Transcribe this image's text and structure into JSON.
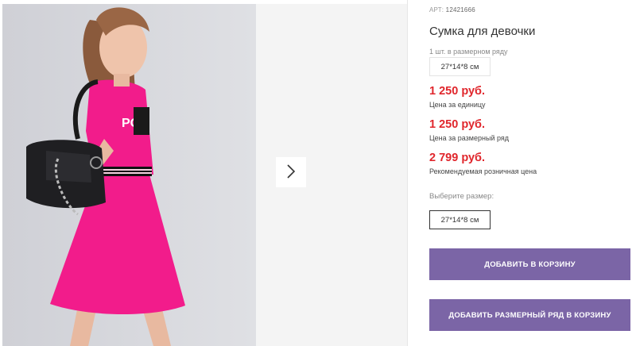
{
  "gallery": {
    "photo_alt": "product-photo",
    "next_icon": "chevron-right-icon"
  },
  "product": {
    "article_label": "АРТ:",
    "article_code": "12421666",
    "title": "Сумка для девочки",
    "set_note": "1 шт. в размерном ряду",
    "set_size": "27*14*8 см"
  },
  "prices": [
    {
      "value": "1 250 руб.",
      "label": "Цена за единицу"
    },
    {
      "value": "1 250 руб.",
      "label": "Цена за размерный ряд"
    },
    {
      "value": "2 799 руб.",
      "label": "Рекомендуемая розничная цена"
    }
  ],
  "size_picker": {
    "label": "Выберите размер:",
    "options": [
      "27*14*8 см"
    ]
  },
  "actions": {
    "add_to_cart": "ДОБАВИТЬ В КОРЗИНУ",
    "add_set_to_cart": "ДОБАВИТЬ РАЗМЕРНЫЙ РЯД В КОРЗИНУ"
  },
  "colors": {
    "price": "#e0262c",
    "button": "#7b65a6"
  }
}
